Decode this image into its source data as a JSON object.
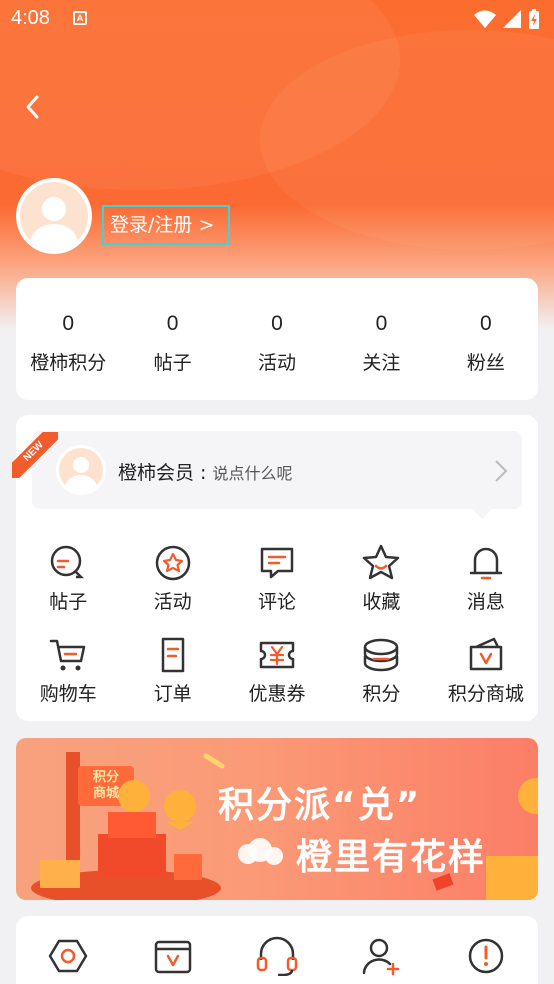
{
  "status_bar": {
    "time": "4:08",
    "app_icon_letter": "A"
  },
  "profile": {
    "login_label": "登录/注册 >"
  },
  "stats": [
    {
      "value": "0",
      "label": "橙柿积分"
    },
    {
      "value": "0",
      "label": "帖子"
    },
    {
      "value": "0",
      "label": "活动"
    },
    {
      "value": "0",
      "label": "关注"
    },
    {
      "value": "0",
      "label": "粉丝"
    }
  ],
  "member": {
    "badge": "NEW",
    "title": "橙柿会员 : ",
    "subtitle": "说点什么呢"
  },
  "menu": [
    {
      "label": "帖子",
      "icon": "chat-bubble-icon"
    },
    {
      "label": "活动",
      "icon": "star-badge-icon"
    },
    {
      "label": "评论",
      "icon": "comment-icon"
    },
    {
      "label": "收藏",
      "icon": "star-icon"
    },
    {
      "label": "消息",
      "icon": "bell-icon"
    },
    {
      "label": "购物车",
      "icon": "cart-icon"
    },
    {
      "label": "订单",
      "icon": "order-icon"
    },
    {
      "label": "优惠券",
      "icon": "coupon-icon"
    },
    {
      "label": "积分",
      "icon": "coins-icon"
    },
    {
      "label": "积分商城",
      "icon": "points-mall-icon"
    }
  ],
  "banner": {
    "line1": "积分派“兑”",
    "line2": "橙里有花样",
    "sign": "积分商城"
  },
  "bottom_icons": [
    "settings-hex-icon",
    "wallet-icon",
    "headset-icon",
    "add-user-icon",
    "alert-icon"
  ],
  "colors": {
    "accent": "#fb6a32",
    "icon_orange": "#f25b2b",
    "highlight": "#41d2d8"
  }
}
